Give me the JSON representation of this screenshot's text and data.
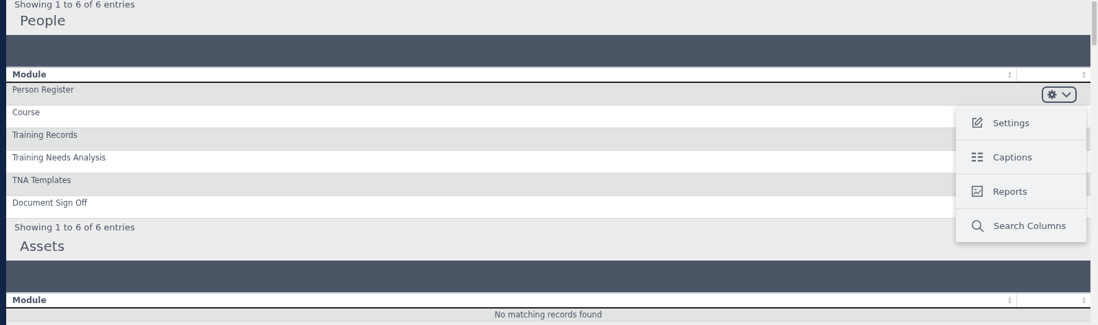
{
  "sections": [
    {
      "top_info": "Showing 1 to 6 of 6 entries",
      "title": "People",
      "columns": [
        "Module"
      ],
      "rows": [
        {
          "module": "Person Register",
          "actions": true
        },
        {
          "module": "Course"
        },
        {
          "module": "Training Records"
        },
        {
          "module": "Training Needs Analysis"
        },
        {
          "module": "TNA Templates"
        },
        {
          "module": "Document Sign Off"
        }
      ],
      "info": "Showing 1 to 6 of 6 entries"
    },
    {
      "title": "Assets",
      "columns": [
        "Module"
      ],
      "empty_message": "No matching records found"
    }
  ],
  "action_menu": {
    "expanded": true,
    "items": [
      {
        "kind": "edit",
        "label": "Settings"
      },
      {
        "kind": "list",
        "label": "Captions"
      },
      {
        "kind": "chart",
        "label": "Reports"
      },
      {
        "kind": "search",
        "label": "Search Columns"
      }
    ]
  }
}
